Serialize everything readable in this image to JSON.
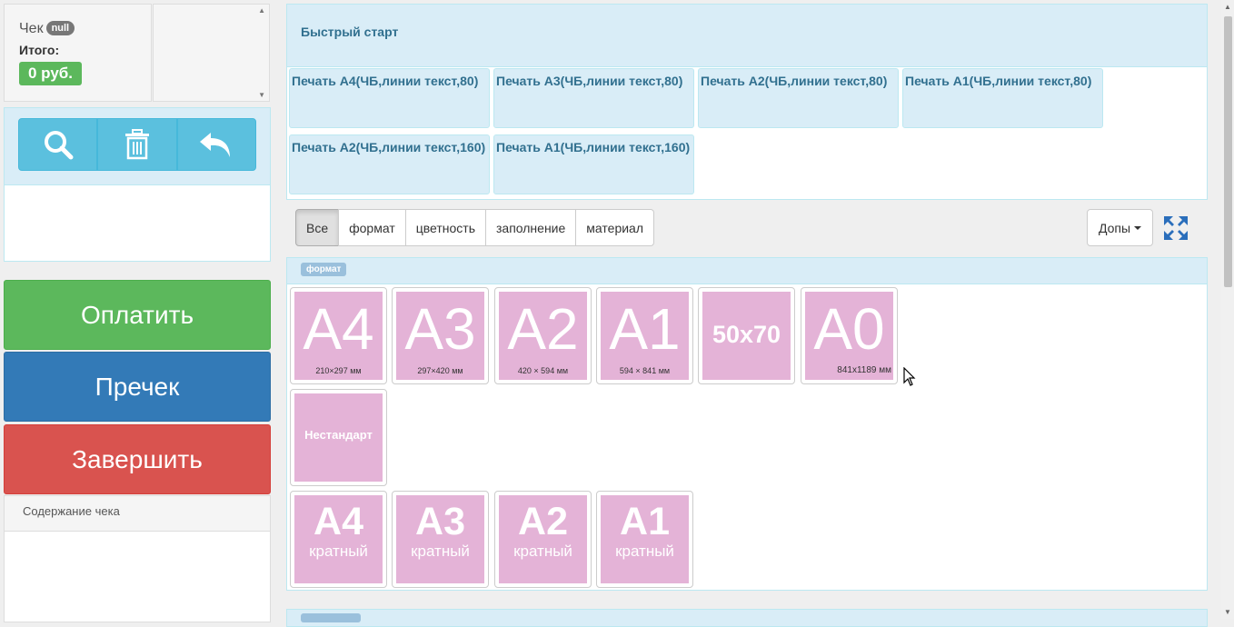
{
  "check": {
    "title": "Чек",
    "badge": "null",
    "total_label": "Итого:",
    "total_value": "0 руб."
  },
  "actions": {
    "pay": "Оплатить",
    "precheck": "Пречек",
    "finish": "Завершить"
  },
  "check_content": {
    "title": "Содержание чека"
  },
  "quick_start": {
    "title": "Быстрый старт",
    "items": [
      "Печать А4(ЧБ,линии текст,80)",
      "Печать А3(ЧБ,линии текст,80)",
      "Печать А2(ЧБ,линии текст,80)",
      "Печать А1(ЧБ,линии текст,80)",
      "Печать А2(ЧБ,линии текст,160)",
      "Печать А1(ЧБ,линии текст,160)"
    ]
  },
  "filters": {
    "tabs": [
      "Все",
      "формат",
      "цветность",
      "заполнение",
      "материал"
    ],
    "active": "Все",
    "extras": "Допы"
  },
  "format_section": {
    "label": "формат",
    "tiles": [
      {
        "big": "A4",
        "dims": "210×297 мм"
      },
      {
        "big": "A3",
        "dims": "297×420 мм"
      },
      {
        "big": "A2",
        "dims": "420 × 594 мм"
      },
      {
        "big": "A1",
        "dims": "594 × 841 мм"
      },
      {
        "big": "50x70",
        "dims": ""
      },
      {
        "big": "A0",
        "dims": "841x1189 мм"
      }
    ],
    "nonstandard": "Нестандарт",
    "multiple": [
      {
        "big": "A4",
        "sub": "кратный"
      },
      {
        "big": "A3",
        "sub": "кратный"
      },
      {
        "big": "A2",
        "sub": "кратный"
      },
      {
        "big": "A1",
        "sub": "кратный"
      }
    ]
  },
  "colors": {
    "success": "#5cb85c",
    "primary": "#337ab7",
    "danger": "#d9534f",
    "info": "#5bc0de",
    "tile": "#e4b3d7",
    "panel_head": "#d9edf7"
  }
}
